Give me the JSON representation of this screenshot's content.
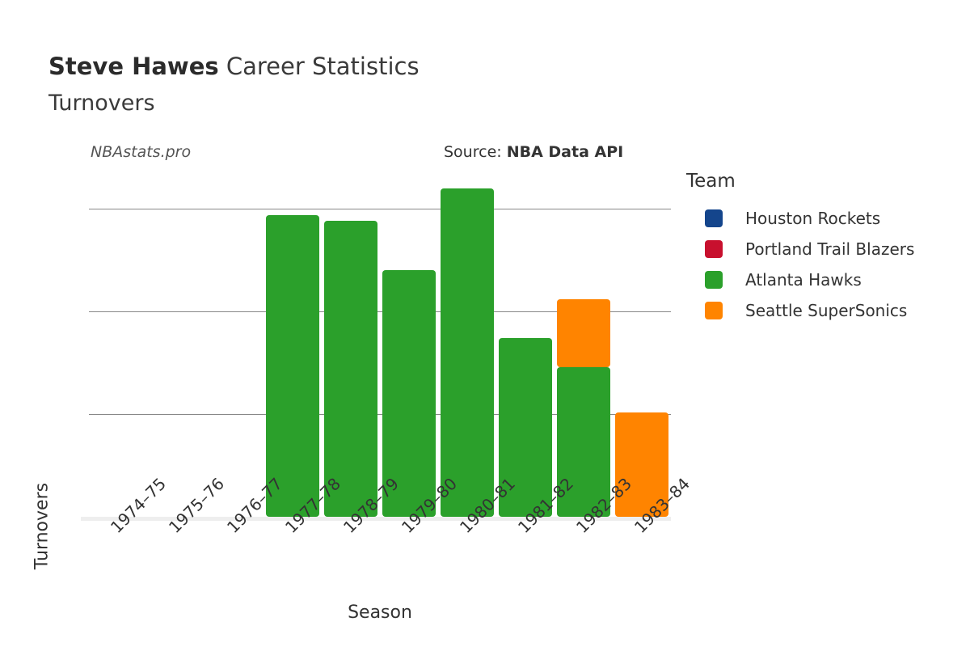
{
  "header": {
    "player_name": "Steve Hawes",
    "title_suffix": " Career Statistics",
    "stat_name": "Turnovers",
    "watermark": "NBAstats.pro",
    "source_label": "Source: ",
    "source_value": "NBA Data API"
  },
  "legend": {
    "title": "Team",
    "items": [
      {
        "label": "Houston Rockets",
        "color": "#14458c"
      },
      {
        "label": "Portland Trail Blazers",
        "color": "#c8102e"
      },
      {
        "label": "Atlanta Hawks",
        "color": "#2ba02b"
      },
      {
        "label": "Seattle SuperSonics",
        "color": "#ff8400"
      }
    ]
  },
  "chart_data": {
    "type": "bar",
    "stacked": true,
    "title": "Steve Hawes Career Statistics — Turnovers",
    "xlabel": "Season",
    "ylabel": "Turnovers",
    "ylim": [
      0,
      165
    ],
    "yticks": [
      0,
      50,
      100,
      150
    ],
    "grid": true,
    "legend_position": "right",
    "categories": [
      "1974–75",
      "1975–76",
      "1976–77",
      "1977–78",
      "1978–79",
      "1979–80",
      "1980–81",
      "1981–82",
      "1982–83",
      "1983–84"
    ],
    "series": [
      {
        "name": "Houston Rockets",
        "color": "#14458c",
        "values": [
          0,
          0,
          0,
          0,
          0,
          0,
          0,
          0,
          0,
          0
        ]
      },
      {
        "name": "Portland Trail Blazers",
        "color": "#c8102e",
        "values": [
          0,
          0,
          0,
          0,
          0,
          0,
          0,
          0,
          0,
          0
        ]
      },
      {
        "name": "Atlanta Hawks",
        "color": "#2ba02b",
        "values": [
          0,
          0,
          0,
          147,
          144,
          120,
          160,
          87,
          73,
          0
        ]
      },
      {
        "name": "Seattle SuperSonics",
        "color": "#ff8400",
        "values": [
          0,
          0,
          0,
          0,
          0,
          0,
          0,
          0,
          33,
          51
        ]
      }
    ],
    "totals": [
      0,
      0,
      0,
      147,
      144,
      120,
      160,
      87,
      106,
      51
    ]
  }
}
